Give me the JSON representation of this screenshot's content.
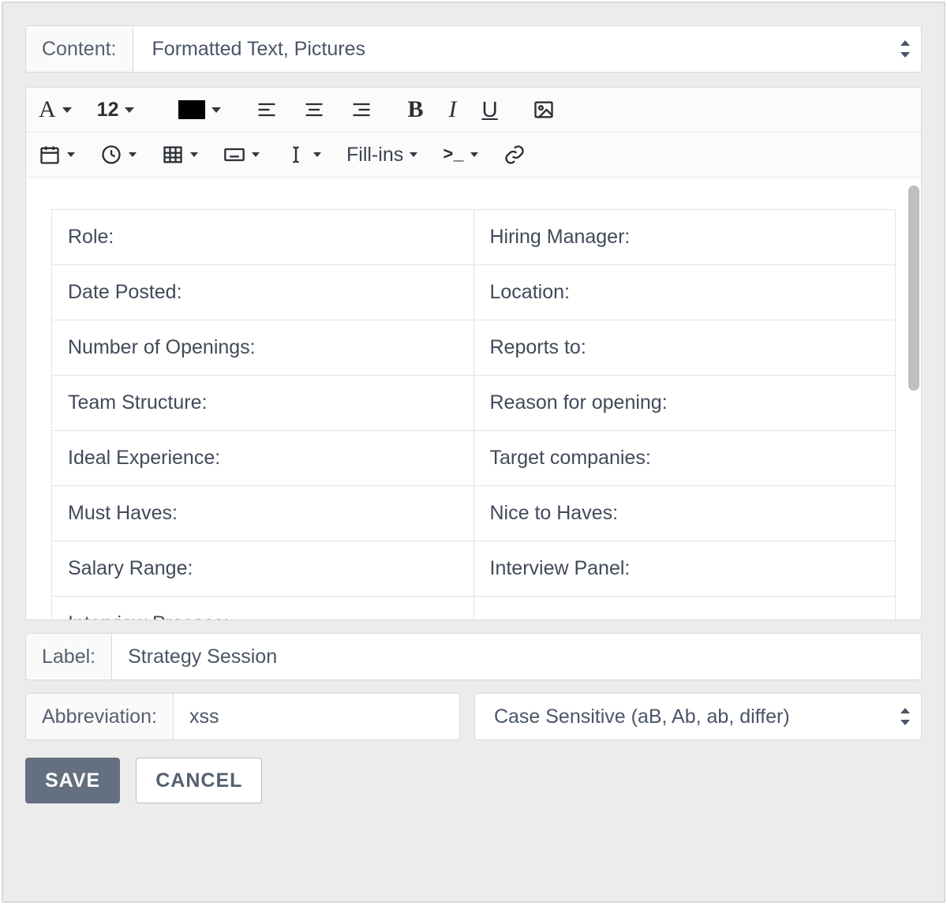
{
  "content_row": {
    "label": "Content:",
    "selected": "Formatted Text, Pictures"
  },
  "toolbar": {
    "font_family_icon_text": "A",
    "font_size": "12",
    "fillins_label": "Fill-ins",
    "prompt_symbol": ">_"
  },
  "table": {
    "rows": [
      {
        "left": "Role:",
        "right": "Hiring Manager:"
      },
      {
        "left": "Date Posted:",
        "right": "Location:"
      },
      {
        "left": "Number of Openings:",
        "right": "Reports to:"
      },
      {
        "left": "Team Structure:",
        "right": "Reason for opening:"
      },
      {
        "left": "Ideal Experience:",
        "right": "Target companies:"
      },
      {
        "left": "Must Haves:",
        "right": "Nice to Haves:"
      },
      {
        "left": "Salary Range:",
        "right": "Interview Panel:"
      },
      {
        "left": "Interview Process:",
        "right": ""
      }
    ]
  },
  "label_row": {
    "label": "Label:",
    "value": "Strategy Session"
  },
  "abbr_row": {
    "label": "Abbreviation:",
    "value": "xss"
  },
  "case_row": {
    "selected": "Case Sensitive (aB, Ab, ab, differ)"
  },
  "buttons": {
    "save": "SAVE",
    "cancel": "CANCEL"
  }
}
